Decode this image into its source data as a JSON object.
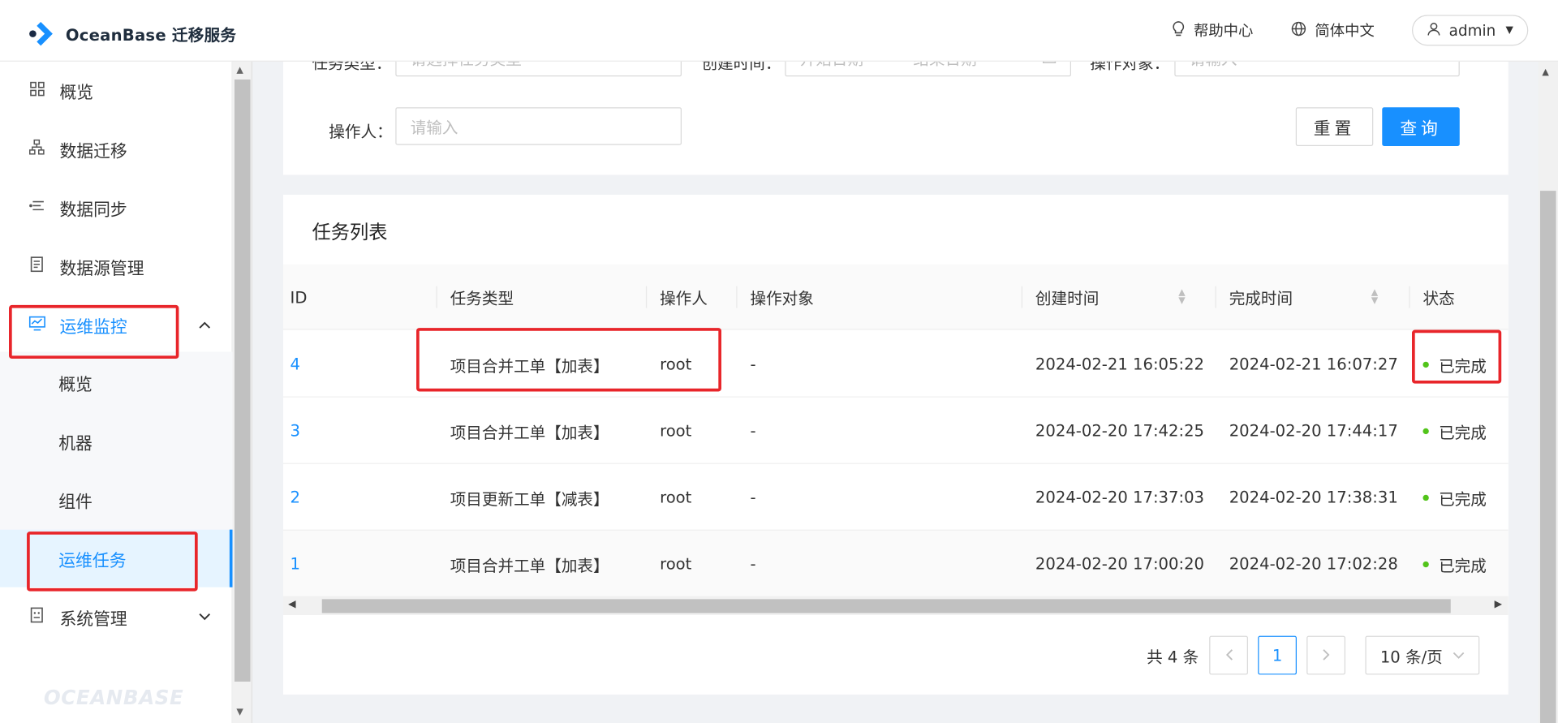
{
  "app": {
    "title": "OceanBase 迁移服务",
    "footer_logo": "OCEANBASE"
  },
  "header": {
    "help": "帮助中心",
    "language": "简体中文",
    "user": "admin"
  },
  "sidebar": {
    "items": [
      {
        "label": "概览",
        "icon": "dashboard-grid-icon"
      },
      {
        "label": "数据迁移",
        "icon": "migration-tree-icon"
      },
      {
        "label": "数据同步",
        "icon": "sync-icon"
      },
      {
        "label": "数据源管理",
        "icon": "datasource-icon"
      },
      {
        "label": "运维监控",
        "icon": "monitor-icon"
      },
      {
        "label": "系统管理",
        "icon": "system-icon"
      }
    ],
    "sub_items": [
      {
        "label": "概览"
      },
      {
        "label": "机器"
      },
      {
        "label": "组件"
      },
      {
        "label": "运维任务"
      }
    ]
  },
  "filters": {
    "task_type_label": "任务类型：",
    "task_type_placeholder": "请选择任务类型",
    "created_label": "创建时间：",
    "start_placeholder": "开始日期",
    "end_placeholder": "结束日期",
    "object_label": "操作对象：",
    "object_placeholder": "请输入",
    "operator_label": "操作人：",
    "operator_placeholder": "请输入",
    "reset": "重置",
    "query": "查询"
  },
  "task_list": {
    "title": "任务列表",
    "columns": [
      "ID",
      "任务类型",
      "操作人",
      "操作对象",
      "创建时间",
      "完成时间",
      "状态"
    ],
    "rows": [
      {
        "id": "4",
        "type": "项目合并工单【加表】",
        "operator": "root",
        "object": "-",
        "created": "2024-02-21 16:05:22",
        "finished": "2024-02-21 16:07:27",
        "status": "已完成"
      },
      {
        "id": "3",
        "type": "项目合并工单【加表】",
        "operator": "root",
        "object": "-",
        "created": "2024-02-20 17:42:25",
        "finished": "2024-02-20 17:44:17",
        "status": "已完成"
      },
      {
        "id": "2",
        "type": "项目更新工单【减表】",
        "operator": "root",
        "object": "-",
        "created": "2024-02-20 17:37:03",
        "finished": "2024-02-20 17:38:31",
        "status": "已完成"
      },
      {
        "id": "1",
        "type": "项目合并工单【加表】",
        "operator": "root",
        "object": "-",
        "created": "2024-02-20 17:00:20",
        "finished": "2024-02-20 17:02:28",
        "status": "已完成"
      }
    ]
  },
  "pagination": {
    "total": "共 4 条",
    "current": "1",
    "page_size": "10 条/页"
  },
  "colors": {
    "accent": "#1890ff",
    "success": "#52c41a",
    "highlight": "#e8252a"
  }
}
